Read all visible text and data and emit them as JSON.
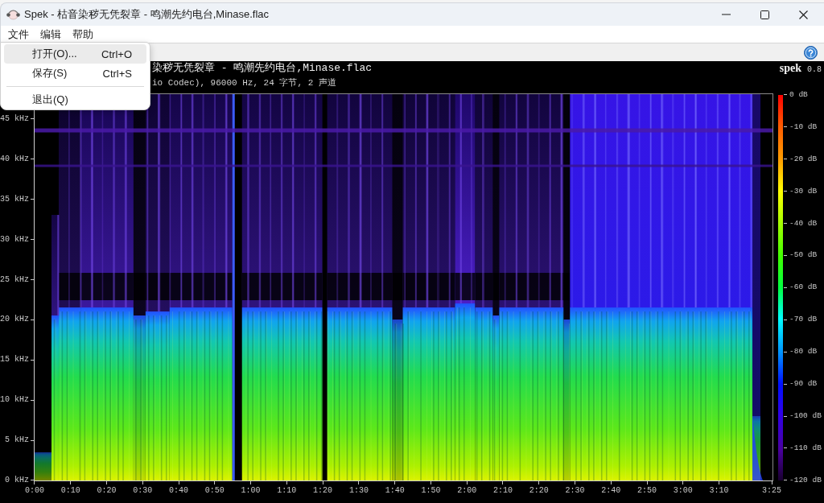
{
  "window": {
    "title": "Spek - 枯音染秽无凭裂章 - 鸣潮先约电台,Minase.flac"
  },
  "menu_bar": [
    "文件",
    "编辑",
    "帮助"
  ],
  "dropdown_menu": {
    "groups": [
      {
        "items": [
          {
            "label": "打开(O)...",
            "shortcut": "Ctrl+O",
            "highlighted": true
          },
          {
            "label": "保存(S)",
            "shortcut": "Ctrl+S",
            "highlighted": false
          }
        ]
      },
      {
        "items": [
          {
            "label": "退出(Q)",
            "highlighted": false
          }
        ]
      }
    ]
  },
  "spectrogram": {
    "file_title": "染秽无凭裂章 - 鸣潮先约电台,Minase.flac",
    "audio_info": "io Codec), 96000 Hz, 24 字节, 2 声道",
    "brand": "spek",
    "version": "0.8",
    "frequency_ticks": [
      "45 kHz",
      "40 kHz",
      "35 kHz",
      "30 kHz",
      "25 kHz",
      "20 kHz",
      "15 kHz",
      "10 kHz",
      "5 kHz",
      "0 kHz"
    ],
    "time_ticks": [
      "0:00",
      "0:10",
      "0:20",
      "0:30",
      "0:40",
      "0:50",
      "1:00",
      "1:10",
      "1:20",
      "1:30",
      "1:40",
      "1:50",
      "2:00",
      "2:10",
      "2:20",
      "2:30",
      "2:40",
      "2:50",
      "3:00",
      "3:10",
      "3:25"
    ],
    "db_ticks": [
      "0 dB",
      "-10 dB",
      "-20 dB",
      "-30 dB",
      "-40 dB",
      "-50 dB",
      "-60 dB",
      "-70 dB",
      "-80 dB",
      "-90 dB",
      "-100 dB",
      "-110 dB",
      "-120 dB"
    ]
  }
}
